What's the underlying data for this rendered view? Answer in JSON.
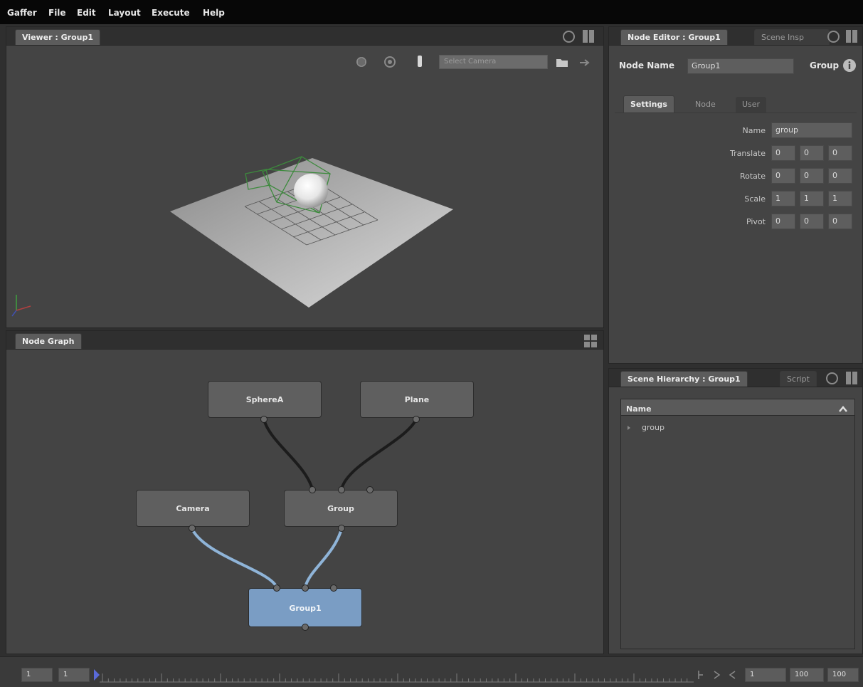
{
  "menu": [
    "Gaffer",
    "File",
    "Edit",
    "Layout",
    "Execute",
    "Help"
  ],
  "viewer": {
    "tab": "Viewer : Group1",
    "camera_placeholder": "Select Camera"
  },
  "node_editor": {
    "tab": "Node Editor : Group1",
    "tab2": "Scene Insp",
    "node_name_label": "Node Name",
    "node_name_value": "Group1",
    "node_type": "Group",
    "tabs": [
      "Settings",
      "Node",
      "User"
    ],
    "fields": [
      {
        "label": "Name",
        "values": [
          "group"
        ]
      },
      {
        "label": "Translate",
        "values": [
          "0",
          "0",
          "0"
        ]
      },
      {
        "label": "Rotate",
        "values": [
          "0",
          "0",
          "0"
        ]
      },
      {
        "label": "Scale",
        "values": [
          "1",
          "1",
          "1"
        ]
      },
      {
        "label": "Pivot",
        "values": [
          "0",
          "0",
          "0"
        ]
      }
    ]
  },
  "node_graph": {
    "tab": "Node Graph",
    "nodes": [
      "SphereA",
      "Plane",
      "Camera",
      "Group",
      "Group1"
    ]
  },
  "hierarchy": {
    "tab": "Scene Hierarchy : Group1",
    "tab2": "Script",
    "column": "Name",
    "items": [
      "group"
    ]
  },
  "timeline": {
    "start": "1",
    "current_left": "1",
    "current": "1",
    "end": "100",
    "max": "100"
  },
  "colors": {
    "selected_node": "#7a9dc4",
    "wire": "#1c1c1c",
    "wire_selected": "#8fb4d8",
    "camera_wire": "#3d8a3d"
  }
}
